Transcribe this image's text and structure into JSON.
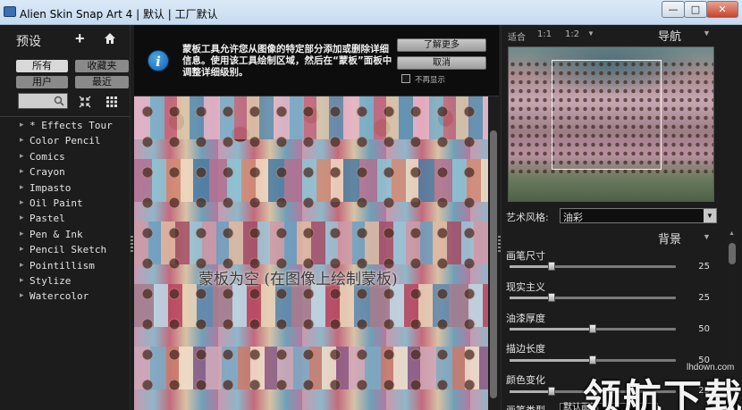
{
  "window": {
    "title": "Alien Skin Snap Art 4 | 默认 | 工厂默认",
    "minimize_label": "—",
    "maximize_label": "□",
    "close_label": "✕"
  },
  "presets": {
    "title": "预设",
    "tabs": [
      {
        "label": "所有",
        "active": true
      },
      {
        "label": "收藏夹",
        "active": false
      },
      {
        "label": "用户",
        "active": false
      },
      {
        "label": "最近",
        "active": false
      }
    ],
    "search_value": "",
    "items": [
      {
        "label": "* Effects Tour"
      },
      {
        "label": "Color Pencil"
      },
      {
        "label": "Comics"
      },
      {
        "label": "Crayon"
      },
      {
        "label": "Impasto"
      },
      {
        "label": "Oil Paint"
      },
      {
        "label": "Pastel"
      },
      {
        "label": "Pen & Ink"
      },
      {
        "label": "Pencil Sketch"
      },
      {
        "label": "Pointillism"
      },
      {
        "label": "Stylize"
      },
      {
        "label": "Watercolor"
      }
    ],
    "icons": [
      "plus-icon",
      "home-icon",
      "search-icon",
      "collapse-icon",
      "grid-view-icon",
      "chevron-right-icon"
    ]
  },
  "infobar": {
    "text": "蒙板工具允许您从图像的特定部分添加或删除详细信息。使用该工具绘制区域，然后在“蒙板”面板中调整详细级别。",
    "learn_more": "了解更多",
    "cancel": "取消",
    "dont_show": "不再显示",
    "dont_show_checked": false,
    "icon": "info-icon"
  },
  "canvas": {
    "mask_message": "蒙板为空 (在图像上绘制蒙板)"
  },
  "navigator": {
    "zoom_fit": "适合",
    "zoom_1_1": "1:1",
    "zoom_1_2": "1:2",
    "title": "导航"
  },
  "style": {
    "label": "艺术风格:",
    "value": "油彩"
  },
  "background": {
    "title": "背景",
    "sliders": [
      {
        "label": "画笔尺寸",
        "value": 25,
        "max": 100
      },
      {
        "label": "现实主义",
        "value": 25,
        "max": 100
      },
      {
        "label": "油漆厚度",
        "value": 50,
        "max": 100
      },
      {
        "label": "描边长度",
        "value": 50,
        "max": 100
      },
      {
        "label": "颜色变化",
        "value": 25,
        "max": 100
      }
    ],
    "bottom_label": "画笔类型",
    "bottom_value": "默认画笔"
  },
  "watermark": {
    "url": "lhdown.com",
    "text": "领航下载"
  },
  "colors": {
    "panel_bg": "#1c1c1c",
    "accent_blue": "#1261a8"
  }
}
